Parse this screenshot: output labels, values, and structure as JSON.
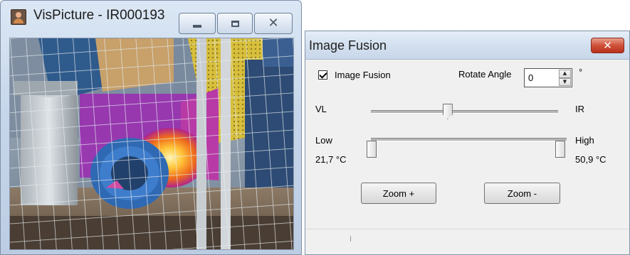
{
  "vispicture": {
    "title": "VisPicture - IR000193"
  },
  "image_fusion": {
    "title": "Image Fusion",
    "checkbox_label": "Image Fusion",
    "checkbox_checked": true,
    "rotate_angle_label": "Rotate Angle",
    "rotate_angle_value": "0",
    "degree_symbol": "°",
    "vl_label": "VL",
    "ir_label": "IR",
    "blend_slider_fraction": 0.41,
    "low_label": "Low",
    "high_label": "High",
    "low_value": "21,7  °C",
    "high_value": "50,9  °C",
    "low_slider_fraction": 0.0,
    "high_slider_fraction": 1.0,
    "zoom_in_label": "Zoom +",
    "zoom_out_label": "Zoom -"
  }
}
